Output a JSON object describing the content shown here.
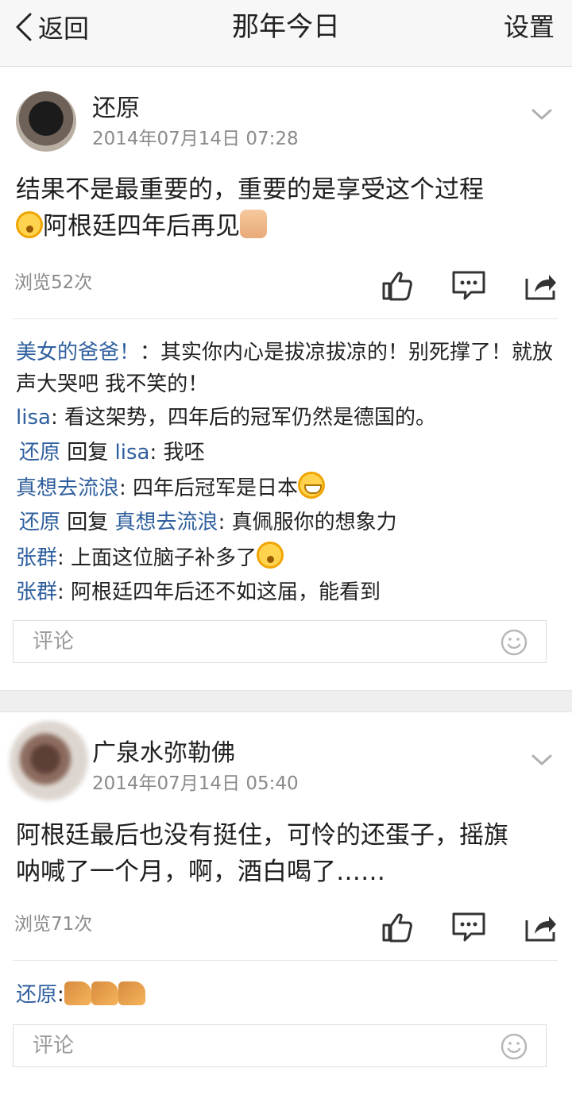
{
  "header": {
    "back_label": "返回",
    "title": "那年今日",
    "settings_label": "设置"
  },
  "posts": [
    {
      "author": "还原",
      "time": "2014年07月14日 07:28",
      "content_line1": "结果不是最重要的，重要的是享受这个过程",
      "content_line2": "阿根廷四年后再见",
      "views": "浏览52次",
      "comments": [
        {
          "name": "美女的爸爸！",
          "text": "：其实你内心是拔凉拔凉的！别死撑了！就放声大哭吧 我不笑的！"
        },
        {
          "name": "lisa",
          "text": ": 看这架势，四年后的冠军仍然是德国的。"
        },
        {
          "name": "还原",
          "reply_word": " 回复 ",
          "target": "lisa",
          "text": ": 我呸"
        },
        {
          "name": "真想去流浪",
          "text": ": 四年后冠军是日本"
        },
        {
          "name": "还原",
          "reply_word": " 回复 ",
          "target": "真想去流浪",
          "text": ": 真佩服你的想象力"
        },
        {
          "name": "张群",
          "text": ": 上面这位脑子补多了"
        },
        {
          "name": "张群",
          "text": ": 阿根廷四年后还不如这届，能看到"
        }
      ],
      "comment_placeholder": "评论"
    },
    {
      "author": "广泉水弥勒佛",
      "time": "2014年07月14日 05:40",
      "content_line1": "阿根廷最后也没有挺住，可怜的还蛋子，摇旗",
      "content_line2": "呐喊了一个月，啊，酒白喝了……",
      "views": "浏览71次",
      "comments": [
        {
          "name": "还原",
          "text": ":"
        }
      ],
      "comment_placeholder": "评论"
    }
  ],
  "icons": {
    "back": "chevron-left-icon",
    "more": "chevron-down-icon",
    "like": "thumbs-up-icon",
    "comment": "comment-icon",
    "share": "share-icon",
    "smile": "smile-icon"
  },
  "colors": {
    "name_blue": "#2f5f9e",
    "muted_gray": "#8a8a8a"
  }
}
